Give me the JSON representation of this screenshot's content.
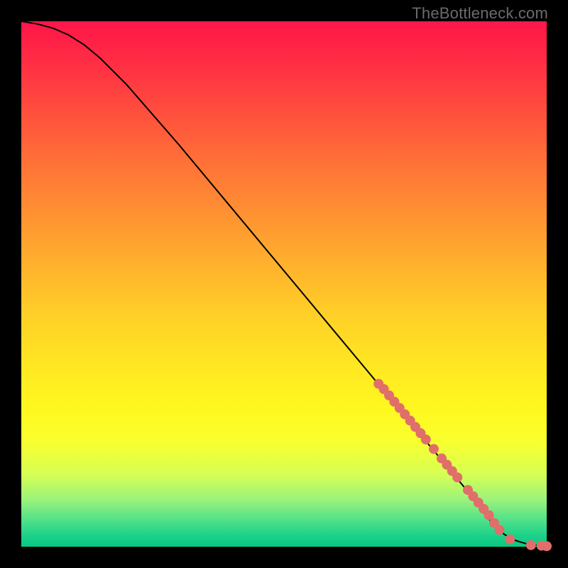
{
  "watermark": "TheBottleneck.com",
  "colors": {
    "curve": "#000000",
    "point_fill": "#e06e6a",
    "point_stroke": "#a84e4b",
    "frame": "#000000"
  },
  "chart_data": {
    "type": "line",
    "title": "",
    "xlabel": "",
    "ylabel": "",
    "xlim": [
      0,
      100
    ],
    "ylim": [
      0,
      100
    ],
    "curve": {
      "x": [
        0,
        3,
        6,
        9,
        12,
        15,
        20,
        30,
        40,
        50,
        60,
        70,
        80,
        85,
        88,
        90,
        92,
        94,
        96,
        98,
        100
      ],
      "y": [
        100,
        99.5,
        98.7,
        97.4,
        95.5,
        93,
        88,
        76.5,
        64.5,
        52.5,
        40.5,
        28.5,
        16.5,
        10.5,
        6.5,
        4,
        2.3,
        1.2,
        0.6,
        0.3,
        0
      ]
    },
    "series": [
      {
        "name": "points",
        "x": [
          68,
          69,
          70,
          71,
          72,
          73,
          74,
          75,
          76,
          77,
          78.5,
          80,
          81,
          82,
          83,
          85,
          86,
          87,
          88,
          89,
          90,
          91,
          93,
          97,
          99,
          100
        ],
        "y": [
          31,
          30,
          28.8,
          27.6,
          26.4,
          25.2,
          24,
          22.8,
          21.6,
          20.4,
          18.6,
          16.8,
          15.6,
          14.4,
          13.2,
          10.8,
          9.6,
          8.4,
          7.2,
          6,
          4.5,
          3.2,
          1.4,
          0.3,
          0.2,
          0.1
        ]
      }
    ]
  }
}
